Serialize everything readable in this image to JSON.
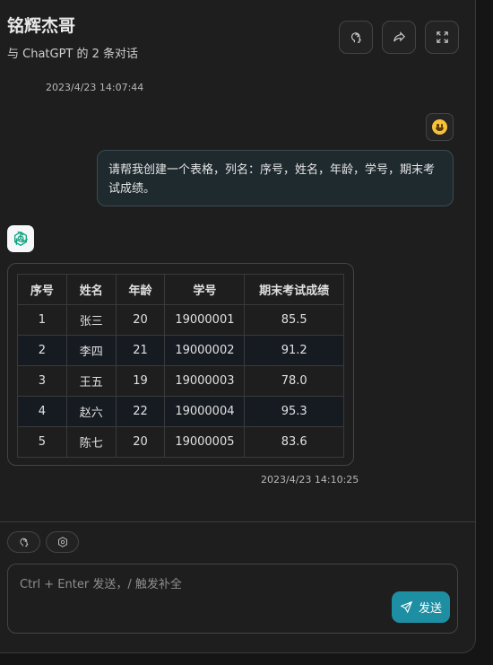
{
  "header": {
    "title": "铭辉杰哥",
    "subtitle": "与 ChatGPT 的 2 条对话"
  },
  "messages": {
    "user_time": "2023/4/23 14:07:44",
    "user_text": "请帮我创建一个表格，列名：序号，姓名，年龄，学号，期末考试成绩。",
    "bot_time": "2023/4/23 14:10:25"
  },
  "table": {
    "headers": [
      "序号",
      "姓名",
      "年龄",
      "学号",
      "期末考试成绩"
    ],
    "rows": [
      [
        "1",
        "张三",
        "20",
        "19000001",
        "85.5"
      ],
      [
        "2",
        "李四",
        "21",
        "19000002",
        "91.2"
      ],
      [
        "3",
        "王五",
        "19",
        "19000003",
        "78.0"
      ],
      [
        "4",
        "赵六",
        "22",
        "19000004",
        "95.3"
      ],
      [
        "5",
        "陈七",
        "20",
        "19000005",
        "83.6"
      ]
    ]
  },
  "composer": {
    "placeholder": "Ctrl + Enter 发送，/ 触发补全",
    "send_label": "发送"
  },
  "colors": {
    "accent": "#1e8ea3",
    "user_bubble": "#1f2a2f"
  },
  "icons": {
    "header_buttons": [
      "brain-icon",
      "share-icon",
      "fullscreen-icon"
    ],
    "chips": [
      "brain-icon",
      "settings-icon"
    ]
  }
}
